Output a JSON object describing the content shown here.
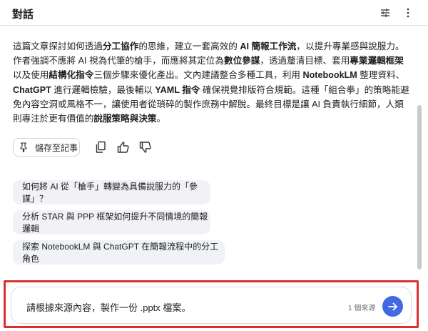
{
  "header": {
    "title": "對話",
    "tune_icon": "tune-icon",
    "more_icon": "more-vert-icon"
  },
  "summary": {
    "segments": [
      {
        "text": "這篇文章探討如何透過",
        "bold": false
      },
      {
        "text": "分工協作",
        "bold": true
      },
      {
        "text": "的思維，建立一套高效的 ",
        "bold": false
      },
      {
        "text": "AI 簡報工作流",
        "bold": true
      },
      {
        "text": "，以提升專業感與說服力。作者強調不應將 AI 視為代筆的槍手，而應將其定位為",
        "bold": false
      },
      {
        "text": "數位參謀",
        "bold": true
      },
      {
        "text": "，透過釐清目標、套用",
        "bold": false
      },
      {
        "text": "專業邏輯框架",
        "bold": true
      },
      {
        "text": "以及使用",
        "bold": false
      },
      {
        "text": "結構化指令",
        "bold": true
      },
      {
        "text": "三個步驟來優化產出。文內建議整合多種工具，利用 ",
        "bold": false
      },
      {
        "text": "NotebookLM",
        "bold": true
      },
      {
        "text": " 整理資料、",
        "bold": false
      },
      {
        "text": "ChatGPT",
        "bold": true
      },
      {
        "text": " 進行邏輯檢驗，最後輔以 ",
        "bold": false
      },
      {
        "text": "YAML 指令",
        "bold": true
      },
      {
        "text": " 確保視覺排版符合規範。這種「組合拳」的策略能避免內容空洞或風格不一，讓使用者從瑣碎的製作庶務中解脫。最終目標是讓 AI 負責執行細節，人類則專注於更有價值的",
        "bold": false
      },
      {
        "text": "說服策略與決策",
        "bold": true
      },
      {
        "text": "。",
        "bold": false
      }
    ]
  },
  "actions": {
    "save_label": "儲存至記事",
    "pin_icon": "pin-icon",
    "copy_icon": "copy-icon",
    "thumb_up_icon": "thumb-up-icon",
    "thumb_down_icon": "thumb-down-icon"
  },
  "suggestions": [
    {
      "label": "如何將 AI 從「槍手」轉變為具備說服力的「參謀」？"
    },
    {
      "label": "分析 STAR 與 PPP 框架如何提升不同情境的簡報邏輯"
    },
    {
      "label": "探索 NotebookLM 與 ChatGPT 在簡報流程中的分工角色"
    }
  ],
  "input": {
    "value": "請根據來源內容，製作一份 .pptx 檔案。",
    "source_count": "1 個來源",
    "send_icon": "arrow-forward-icon"
  },
  "colors": {
    "accent": "#4169e1",
    "highlight": "#d9302d",
    "chip_bg": "#f0f2f5"
  }
}
